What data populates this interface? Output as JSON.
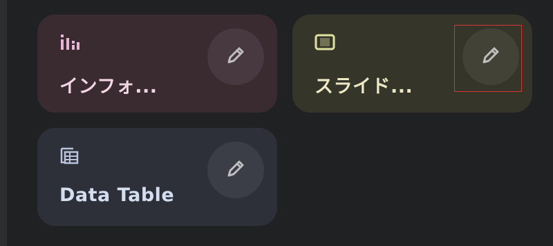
{
  "cards": [
    {
      "id": "infographic",
      "label": "インフォ...",
      "icon": "bar-chart-icon",
      "icon_color": "#e6b6d6",
      "accent": "#3a2b31"
    },
    {
      "id": "slide",
      "label": "スライド...",
      "icon": "slides-icon",
      "icon_color": "#e2e2a2",
      "accent": "#35352a"
    },
    {
      "id": "datatable",
      "label": "Data Table",
      "icon": "table-icon",
      "icon_color": "#b9c4dc",
      "accent": "#2d3039"
    }
  ],
  "edit_button": {
    "icon": "pencil-icon",
    "icon_color": "#bfbfbf"
  },
  "colors": {
    "background": "#1f2122",
    "highlight": "#d8342f"
  }
}
